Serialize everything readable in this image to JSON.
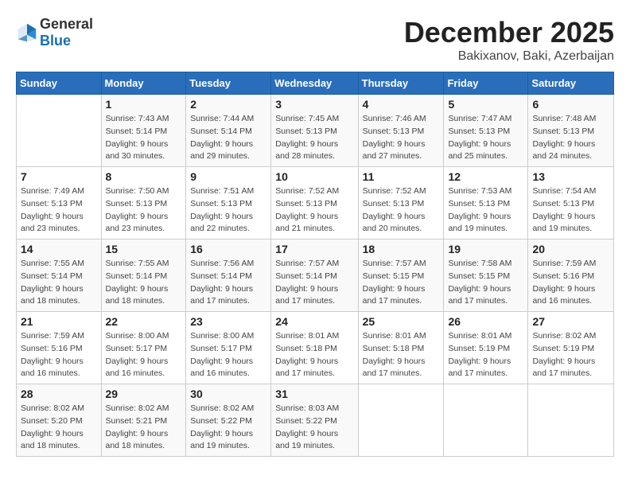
{
  "header": {
    "logo_general": "General",
    "logo_blue": "Blue",
    "month": "December 2025",
    "location": "Bakixanov, Baki, Azerbaijan"
  },
  "days_of_week": [
    "Sunday",
    "Monday",
    "Tuesday",
    "Wednesday",
    "Thursday",
    "Friday",
    "Saturday"
  ],
  "weeks": [
    [
      {
        "day": "",
        "info": ""
      },
      {
        "day": "1",
        "info": "Sunrise: 7:43 AM\nSunset: 5:14 PM\nDaylight: 9 hours\nand 30 minutes."
      },
      {
        "day": "2",
        "info": "Sunrise: 7:44 AM\nSunset: 5:14 PM\nDaylight: 9 hours\nand 29 minutes."
      },
      {
        "day": "3",
        "info": "Sunrise: 7:45 AM\nSunset: 5:13 PM\nDaylight: 9 hours\nand 28 minutes."
      },
      {
        "day": "4",
        "info": "Sunrise: 7:46 AM\nSunset: 5:13 PM\nDaylight: 9 hours\nand 27 minutes."
      },
      {
        "day": "5",
        "info": "Sunrise: 7:47 AM\nSunset: 5:13 PM\nDaylight: 9 hours\nand 25 minutes."
      },
      {
        "day": "6",
        "info": "Sunrise: 7:48 AM\nSunset: 5:13 PM\nDaylight: 9 hours\nand 24 minutes."
      }
    ],
    [
      {
        "day": "7",
        "info": "Sunrise: 7:49 AM\nSunset: 5:13 PM\nDaylight: 9 hours\nand 23 minutes."
      },
      {
        "day": "8",
        "info": "Sunrise: 7:50 AM\nSunset: 5:13 PM\nDaylight: 9 hours\nand 23 minutes."
      },
      {
        "day": "9",
        "info": "Sunrise: 7:51 AM\nSunset: 5:13 PM\nDaylight: 9 hours\nand 22 minutes."
      },
      {
        "day": "10",
        "info": "Sunrise: 7:52 AM\nSunset: 5:13 PM\nDaylight: 9 hours\nand 21 minutes."
      },
      {
        "day": "11",
        "info": "Sunrise: 7:52 AM\nSunset: 5:13 PM\nDaylight: 9 hours\nand 20 minutes."
      },
      {
        "day": "12",
        "info": "Sunrise: 7:53 AM\nSunset: 5:13 PM\nDaylight: 9 hours\nand 19 minutes."
      },
      {
        "day": "13",
        "info": "Sunrise: 7:54 AM\nSunset: 5:13 PM\nDaylight: 9 hours\nand 19 minutes."
      }
    ],
    [
      {
        "day": "14",
        "info": "Sunrise: 7:55 AM\nSunset: 5:14 PM\nDaylight: 9 hours\nand 18 minutes."
      },
      {
        "day": "15",
        "info": "Sunrise: 7:55 AM\nSunset: 5:14 PM\nDaylight: 9 hours\nand 18 minutes."
      },
      {
        "day": "16",
        "info": "Sunrise: 7:56 AM\nSunset: 5:14 PM\nDaylight: 9 hours\nand 17 minutes."
      },
      {
        "day": "17",
        "info": "Sunrise: 7:57 AM\nSunset: 5:14 PM\nDaylight: 9 hours\nand 17 minutes."
      },
      {
        "day": "18",
        "info": "Sunrise: 7:57 AM\nSunset: 5:15 PM\nDaylight: 9 hours\nand 17 minutes."
      },
      {
        "day": "19",
        "info": "Sunrise: 7:58 AM\nSunset: 5:15 PM\nDaylight: 9 hours\nand 17 minutes."
      },
      {
        "day": "20",
        "info": "Sunrise: 7:59 AM\nSunset: 5:16 PM\nDaylight: 9 hours\nand 16 minutes."
      }
    ],
    [
      {
        "day": "21",
        "info": "Sunrise: 7:59 AM\nSunset: 5:16 PM\nDaylight: 9 hours\nand 16 minutes."
      },
      {
        "day": "22",
        "info": "Sunrise: 8:00 AM\nSunset: 5:17 PM\nDaylight: 9 hours\nand 16 minutes."
      },
      {
        "day": "23",
        "info": "Sunrise: 8:00 AM\nSunset: 5:17 PM\nDaylight: 9 hours\nand 16 minutes."
      },
      {
        "day": "24",
        "info": "Sunrise: 8:01 AM\nSunset: 5:18 PM\nDaylight: 9 hours\nand 17 minutes."
      },
      {
        "day": "25",
        "info": "Sunrise: 8:01 AM\nSunset: 5:18 PM\nDaylight: 9 hours\nand 17 minutes."
      },
      {
        "day": "26",
        "info": "Sunrise: 8:01 AM\nSunset: 5:19 PM\nDaylight: 9 hours\nand 17 minutes."
      },
      {
        "day": "27",
        "info": "Sunrise: 8:02 AM\nSunset: 5:19 PM\nDaylight: 9 hours\nand 17 minutes."
      }
    ],
    [
      {
        "day": "28",
        "info": "Sunrise: 8:02 AM\nSunset: 5:20 PM\nDaylight: 9 hours\nand 18 minutes."
      },
      {
        "day": "29",
        "info": "Sunrise: 8:02 AM\nSunset: 5:21 PM\nDaylight: 9 hours\nand 18 minutes."
      },
      {
        "day": "30",
        "info": "Sunrise: 8:02 AM\nSunset: 5:22 PM\nDaylight: 9 hours\nand 19 minutes."
      },
      {
        "day": "31",
        "info": "Sunrise: 8:03 AM\nSunset: 5:22 PM\nDaylight: 9 hours\nand 19 minutes."
      },
      {
        "day": "",
        "info": ""
      },
      {
        "day": "",
        "info": ""
      },
      {
        "day": "",
        "info": ""
      }
    ]
  ]
}
